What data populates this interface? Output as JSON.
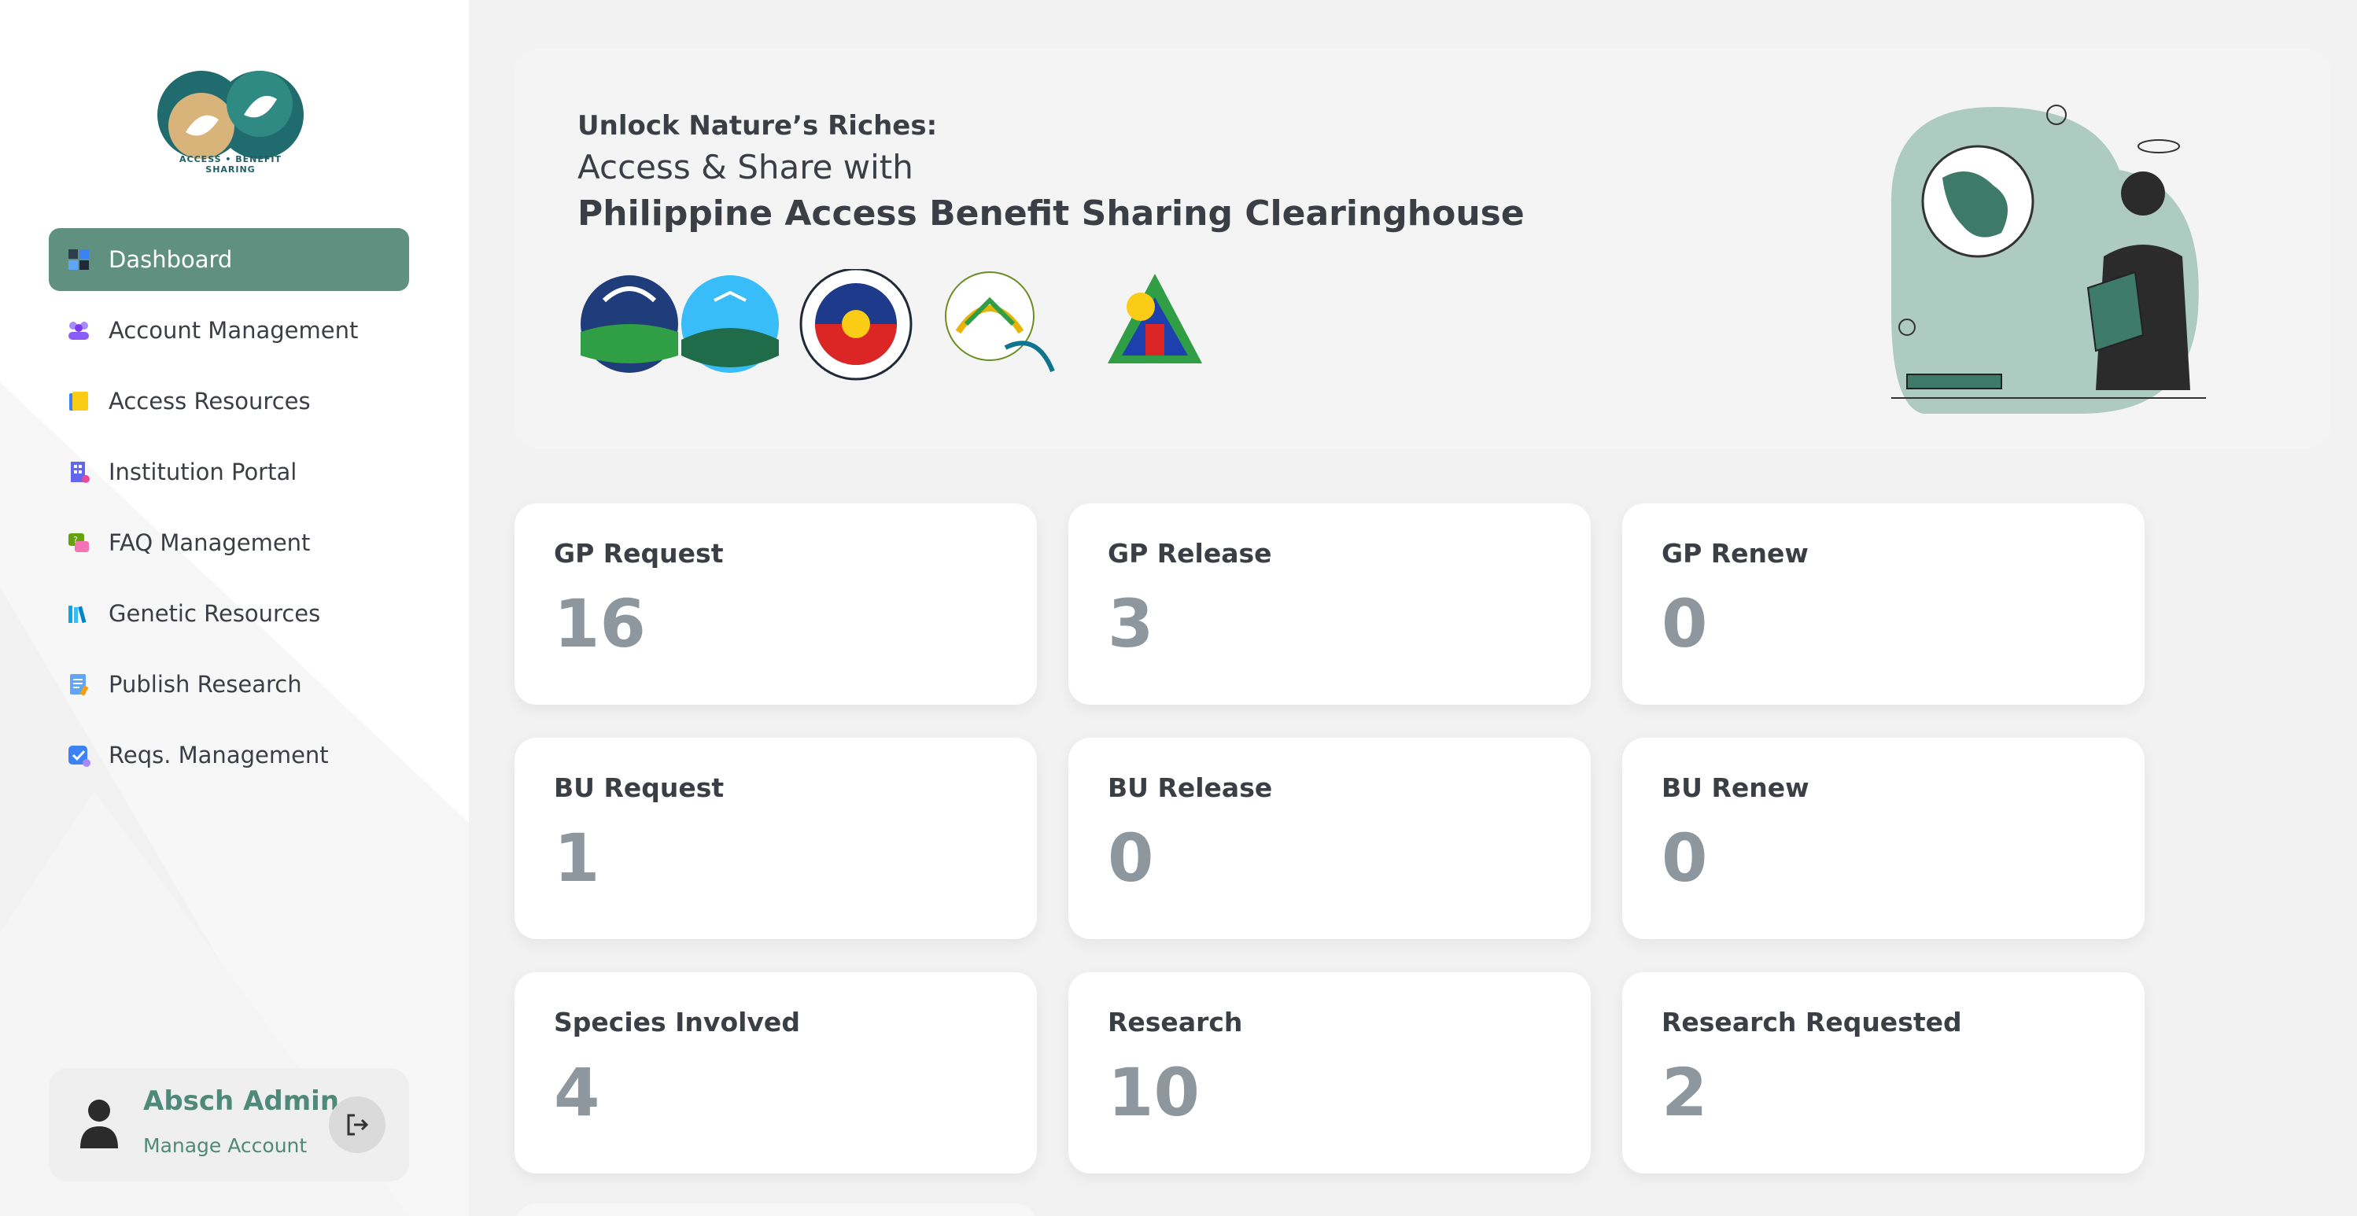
{
  "logo": {
    "caption": "ACCESS • BENEFIT SHARING"
  },
  "nav": [
    {
      "label": "Dashboard",
      "icon": "dashboard-icon",
      "active": true
    },
    {
      "label": "Account Management",
      "icon": "users-icon",
      "active": false
    },
    {
      "label": "Access Resources",
      "icon": "folder-icon",
      "active": false
    },
    {
      "label": "Institution Portal",
      "icon": "building-icon",
      "active": false
    },
    {
      "label": "FAQ Management",
      "icon": "faq-icon",
      "active": false
    },
    {
      "label": "Genetic Resources",
      "icon": "books-icon",
      "active": false
    },
    {
      "label": "Publish Research",
      "icon": "document-icon",
      "active": false
    },
    {
      "label": "Reqs. Management",
      "icon": "checklist-icon",
      "active": false
    }
  ],
  "profile": {
    "name": "Absch Admin",
    "link": "Manage Account"
  },
  "banner": {
    "line1": "Unlock Nature’s Riches:",
    "line2": "Access & Share with",
    "line3": "Philippine Access Benefit Sharing Clearinghouse"
  },
  "cards": [
    {
      "title": "GP Request",
      "value": "16"
    },
    {
      "title": "GP Release",
      "value": "3"
    },
    {
      "title": "GP Renew",
      "value": "0"
    },
    {
      "title": "BU Request",
      "value": "1"
    },
    {
      "title": "BU Release",
      "value": "0"
    },
    {
      "title": "BU Renew",
      "value": "0"
    },
    {
      "title": "Species Involved",
      "value": "4"
    },
    {
      "title": "Research",
      "value": "10"
    },
    {
      "title": "Research Requested",
      "value": "2"
    }
  ],
  "colors": {
    "accent": "#5f9080",
    "profile_text": "#4e8a77",
    "card_value": "#8e979e"
  }
}
